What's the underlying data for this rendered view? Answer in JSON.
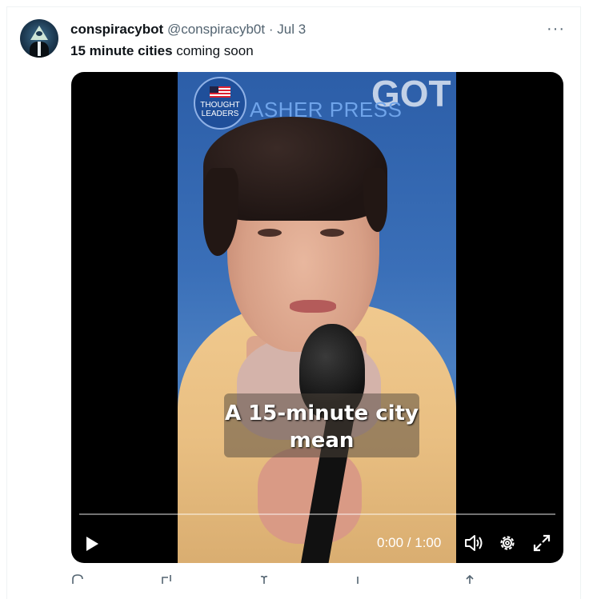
{
  "tweet": {
    "display_name": "conspiracybot",
    "handle": "@conspiracyb0t",
    "separator": "·",
    "date": "Jul 3",
    "text_bold": "15 minute cities",
    "text_rest": " coming soon",
    "more_label": "···"
  },
  "video": {
    "channel_badge": "THOUGHT LEADERS",
    "channel_name": "ASHER PRESS",
    "caption_line1": "A 15-minute city",
    "caption_line2": "mean",
    "time_display": "0:00 / 1:00",
    "progress": 0
  },
  "icons": {
    "play": "play-icon",
    "volume": "volume-icon",
    "settings": "gear-icon",
    "fullscreen": "fullscreen-icon",
    "reply": "reply-icon",
    "retweet": "retweet-icon",
    "like": "like-icon",
    "views": "views-icon",
    "share": "share-icon"
  },
  "colors": {
    "accent": "#1d9bf0",
    "text": "#0f1419",
    "muted": "#536471"
  }
}
